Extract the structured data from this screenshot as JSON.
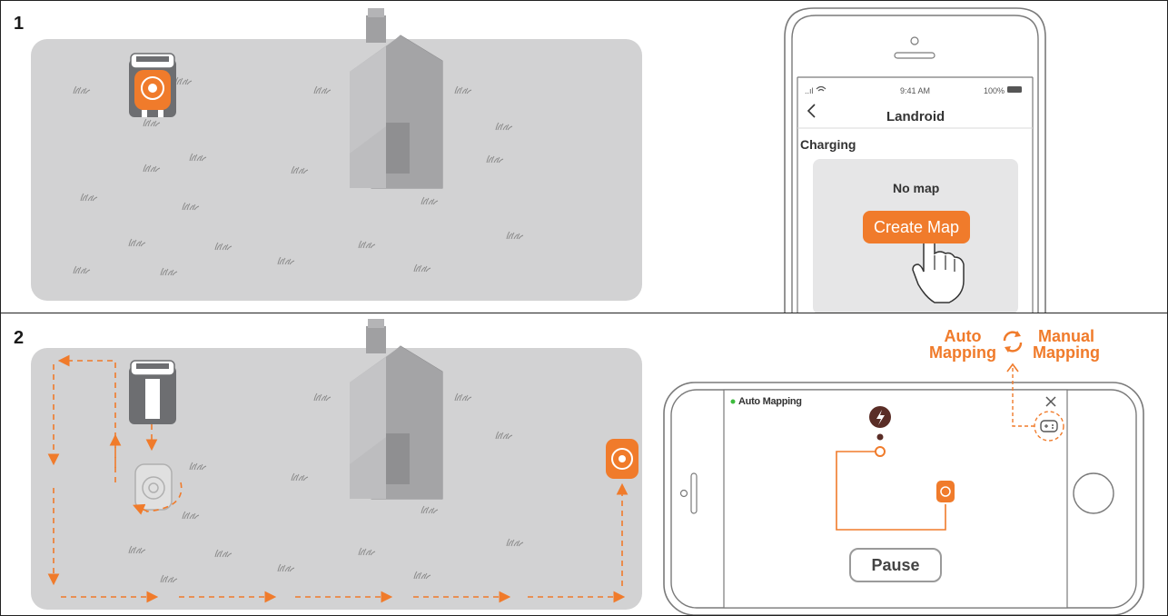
{
  "colors": {
    "accent": "#f07b2b",
    "lawn": "#d2d2d3",
    "house": "#a6a6a8",
    "grass": "#7a7a7a",
    "robot_gray": "#6d6e71",
    "line": "#2a2a2a"
  },
  "step1": {
    "number": "1",
    "phone": {
      "status_time": "9:41 AM",
      "status_signal": "..ıl",
      "status_battery": "100%",
      "back_icon": "chevron-left-icon",
      "title": "Landroid",
      "status_label": "Charging",
      "map_message": "No map",
      "create_button": "Create Map"
    }
  },
  "step2": {
    "number": "2",
    "phone": {
      "mode_label": "Auto Mapping",
      "close_icon": "close-icon",
      "pause_button": "Pause",
      "controller_icon": "gamepad-icon"
    },
    "callout": {
      "auto_line1": "Auto",
      "auto_line2": "Mapping",
      "manual_line1": "Manual",
      "manual_line2": "Mapping",
      "swap_icon": "swap-arrows-icon"
    }
  }
}
